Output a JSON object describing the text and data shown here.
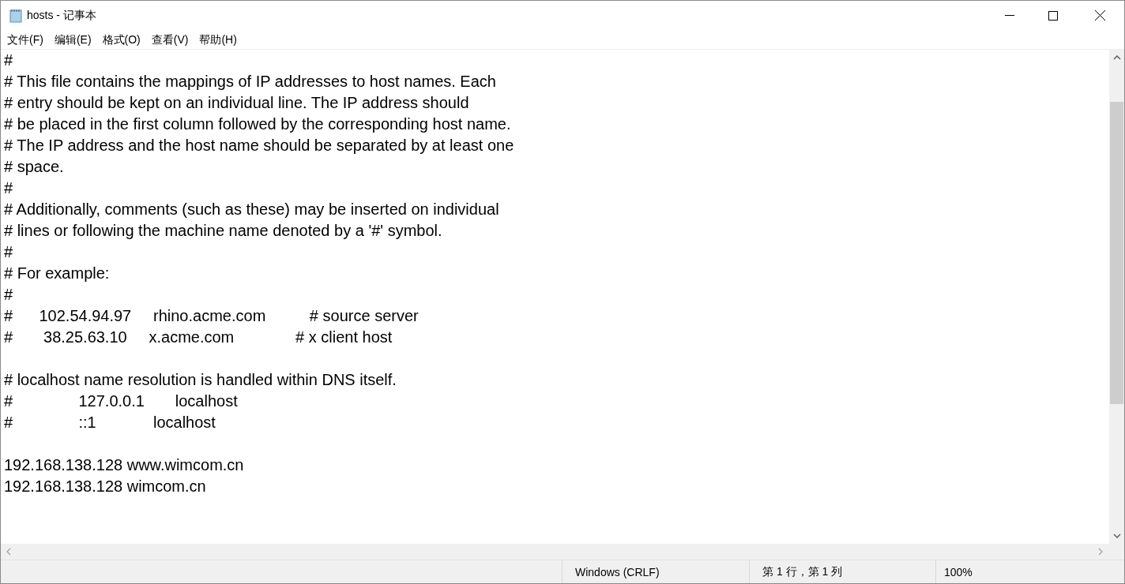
{
  "window": {
    "title": "hosts - 记事本"
  },
  "menu": [
    {
      "label": "文件(F)"
    },
    {
      "label": "编辑(E)"
    },
    {
      "label": "格式(O)"
    },
    {
      "label": "查看(V)"
    },
    {
      "label": "帮助(H)"
    }
  ],
  "editor": {
    "content": "#\n# This file contains the mappings of IP addresses to host names. Each\n# entry should be kept on an individual line. The IP address should\n# be placed in the first column followed by the corresponding host name.\n# The IP address and the host name should be separated by at least one\n# space.\n#\n# Additionally, comments (such as these) may be inserted on individual\n# lines or following the machine name denoted by a '#' symbol.\n#\n# For example:\n#\n#      102.54.94.97     rhino.acme.com          # source server\n#       38.25.63.10     x.acme.com              # x client host\n\n# localhost name resolution is handled within DNS itself.\n#\t127.0.0.1       localhost\n#\t::1             localhost\n\n192.168.138.128 www.wimcom.cn\n192.168.138.128 wimcom.cn"
  },
  "status_bar": {
    "line_ending": "Windows (CRLF)",
    "position": "第 1 行，第 1 列",
    "zoom": "100%"
  }
}
